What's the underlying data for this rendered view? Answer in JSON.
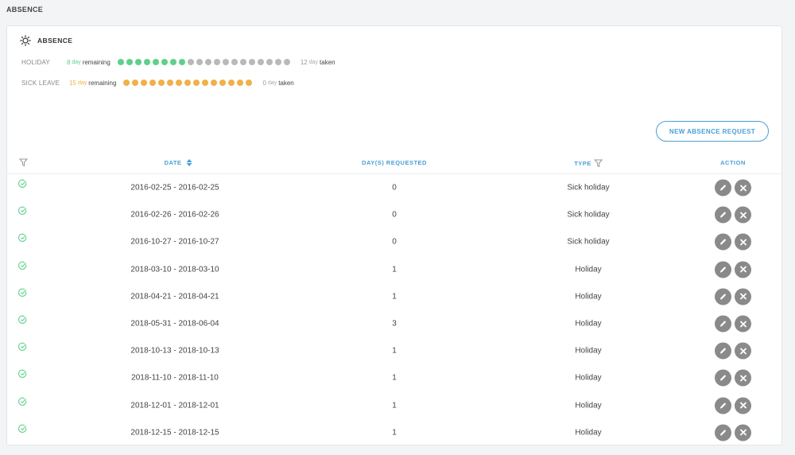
{
  "page_title": "ABSENCE",
  "card": {
    "title": "ABSENCE",
    "icon": "sun-icon",
    "balances": [
      {
        "label": "HOLIDAY",
        "remaining": "8",
        "unit": "day",
        "remaining_text": "remaining",
        "taken": "12",
        "taken_text": "taken",
        "color": "#5fd08c",
        "filled": 8,
        "total": 20
      },
      {
        "label": "SICK LEAVE",
        "remaining": "15",
        "unit": "day",
        "remaining_text": "remaining",
        "taken": "0",
        "taken_text": "taken",
        "color": "#f0b04a",
        "filled": 15,
        "total": 15
      }
    ]
  },
  "new_request_label": "NEW ABSENCE REQUEST",
  "table": {
    "headers": {
      "date": "DATE",
      "days": "DAY(S) REQUESTED",
      "type": "TYPE",
      "action": "ACTION"
    },
    "rows": [
      {
        "date": "2016-02-25 - 2016-02-25",
        "days": "0",
        "type": "Sick holiday"
      },
      {
        "date": "2016-02-26 - 2016-02-26",
        "days": "0",
        "type": "Sick holiday"
      },
      {
        "date": "2016-10-27 - 2016-10-27",
        "days": "0",
        "type": "Sick holiday"
      },
      {
        "date": "2018-03-10 - 2018-03-10",
        "days": "1",
        "type": "Holiday"
      },
      {
        "date": "2018-04-21 - 2018-04-21",
        "days": "1",
        "type": "Holiday"
      },
      {
        "date": "2018-05-31 - 2018-06-04",
        "days": "3",
        "type": "Holiday"
      },
      {
        "date": "2018-10-13 - 2018-10-13",
        "days": "1",
        "type": "Holiday"
      },
      {
        "date": "2018-11-10 - 2018-11-10",
        "days": "1",
        "type": "Holiday"
      },
      {
        "date": "2018-12-01 - 2018-12-01",
        "days": "1",
        "type": "Holiday"
      },
      {
        "date": "2018-12-15 - 2018-12-15",
        "days": "1",
        "type": "Holiday"
      }
    ]
  },
  "colors": {
    "accent": "#4a9fd8",
    "approved": "#5fd08c",
    "empty_dot": "#b9b9b9",
    "action_bg": "#8a8a8a"
  }
}
